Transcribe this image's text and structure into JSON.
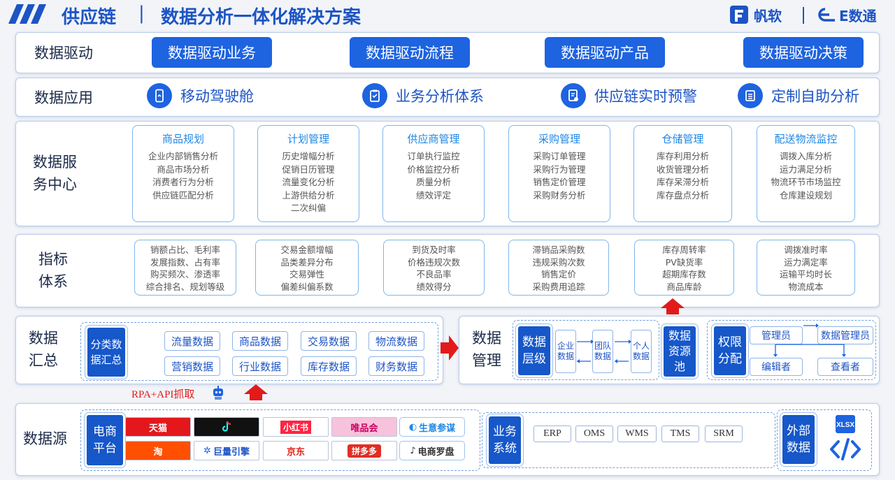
{
  "header": {
    "title_left": "供应链",
    "separator": "|",
    "title_right": "数据分析一体化解决方案",
    "logo1": "帆软",
    "logo2": "E数通",
    "brand_color": "#1d54c4"
  },
  "drive": {
    "label": "数据驱动",
    "buttons": [
      "数据驱动业务",
      "数据驱动流程",
      "数据驱动产品",
      "数据驱动决策"
    ]
  },
  "apps": {
    "label": "数据应用",
    "items": [
      {
        "label": "移动驾驶舱",
        "icon": "mobile-icon"
      },
      {
        "label": "业务分析体系",
        "icon": "clipboard-icon"
      },
      {
        "label": "供应链实时预警",
        "icon": "alert-doc-icon"
      },
      {
        "label": "定制自助分析",
        "icon": "list-icon"
      }
    ]
  },
  "service": {
    "label_line1": "数据服",
    "label_line2": "务中心",
    "cards": [
      {
        "title": "商品规划",
        "lines": [
          "企业内部销售分析",
          "商品市场分析",
          "消费者行为分析",
          "供应链匹配分析"
        ]
      },
      {
        "title": "计划管理",
        "lines": [
          "历史增幅分析",
          "促销日历管理",
          "流量变化分析",
          "上游供给分析",
          "二次纠偏"
        ]
      },
      {
        "title": "供应商管理",
        "lines": [
          "订单执行监控",
          "价格监控分析",
          "质量分析",
          "绩效评定"
        ]
      },
      {
        "title": "采购管理",
        "lines": [
          "采购订单管理",
          "采购行为管理",
          "销售定价管理",
          "采购财务分析"
        ]
      },
      {
        "title": "仓储管理",
        "lines": [
          "库存利用分析",
          "收货管理分析",
          "库存呆滞分析",
          "库存盘点分析"
        ]
      },
      {
        "title": "配送物流监控",
        "lines": [
          "调拨入库分析",
          "运力满足分析",
          "物流环节市场监控",
          "仓库建设规划"
        ]
      }
    ]
  },
  "metrics": {
    "label_line1": "指标",
    "label_line2": "体系",
    "cards": [
      [
        "销额占比、毛利率",
        "发展指数、占有率",
        "购买频次、渗透率",
        "综合排名、规划等级"
      ],
      [
        "交易金额增幅",
        "品类差异分布",
        "交易弹性",
        "偏差纠偏系数"
      ],
      [
        "到货及时率",
        "价格违规次数",
        "不良品率",
        "绩效得分"
      ],
      [
        "滞销品采购数",
        "违规采购次数",
        "销售定价",
        "采购费用追踪"
      ],
      [
        "库存周转率",
        "PV缺货率",
        "超期库存数",
        "商品库龄"
      ],
      [
        "调拨准时率",
        "运力满定率",
        "运输平均时长",
        "物流成本"
      ]
    ]
  },
  "summary": {
    "label_line1": "数据",
    "label_line2": "汇总",
    "block_line1": "分类数",
    "block_line2": "据汇总",
    "tags": [
      "流量数据",
      "商品数据",
      "交易数据",
      "物流数据",
      "营销数据",
      "行业数据",
      "库存数据",
      "财务数据"
    ],
    "rpa": "RPA+API抓取"
  },
  "management": {
    "label_line1": "数据",
    "label_line2": "管理",
    "level_line1": "数据",
    "level_line2": "层级",
    "levels": [
      [
        "企业",
        "数据"
      ],
      [
        "团队",
        "数据"
      ],
      [
        "个人",
        "数据"
      ]
    ],
    "pool": [
      "数据",
      "资源",
      "池"
    ],
    "perm_line1": "权限",
    "perm_line2": "分配",
    "roles": [
      "管理员",
      "数据管理员",
      "编辑者",
      "查看者"
    ]
  },
  "sources": {
    "label": "数据源",
    "ecom_line1": "电商",
    "ecom_line2": "平台",
    "platforms": [
      {
        "name": "天猫",
        "color": "#e4171c",
        "bg": "#e4171c",
        "fg": "#fff"
      },
      {
        "name": "抖音",
        "color": "#111",
        "bg": "#111",
        "fg": "#fff"
      },
      {
        "name": "小红书",
        "color": "#ff2442",
        "bg": "#ff2442",
        "fg": "#fff"
      },
      {
        "name": "唯品会",
        "color": "#f10180",
        "bg": "#f7c2dc",
        "fg": "#c8005f"
      },
      {
        "name": "生意参谋",
        "color": "#1e88e5",
        "bg": "#fff",
        "fg": "#1e88e5"
      },
      {
        "name": "淘",
        "color": "#ff5000",
        "bg": "#ff5000",
        "fg": "#fff"
      },
      {
        "name": "巨量引擎",
        "color": "#1e63e0",
        "bg": "#fff",
        "fg": "#1d54c4"
      },
      {
        "name": "京东",
        "color": "#e1251b",
        "bg": "#fff",
        "fg": "#e1251b"
      },
      {
        "name": "拼多多",
        "color": "#e02e24",
        "bg": "#e02e24",
        "fg": "#fff"
      },
      {
        "name": "电商罗盘",
        "color": "#111",
        "bg": "#fff",
        "fg": "#111"
      }
    ],
    "biz_line1": "业务",
    "biz_line2": "系统",
    "systems": [
      "ERP",
      "OMS",
      "WMS",
      "TMS",
      "SRM"
    ],
    "ext_line1": "外部",
    "ext_line2": "数据",
    "xlsx": "XLSX"
  },
  "colors": {
    "primary": "#1e63e0",
    "dark_block": "#1657c9",
    "accent_red": "#e31a1a",
    "card_title": "#1e88e5"
  }
}
